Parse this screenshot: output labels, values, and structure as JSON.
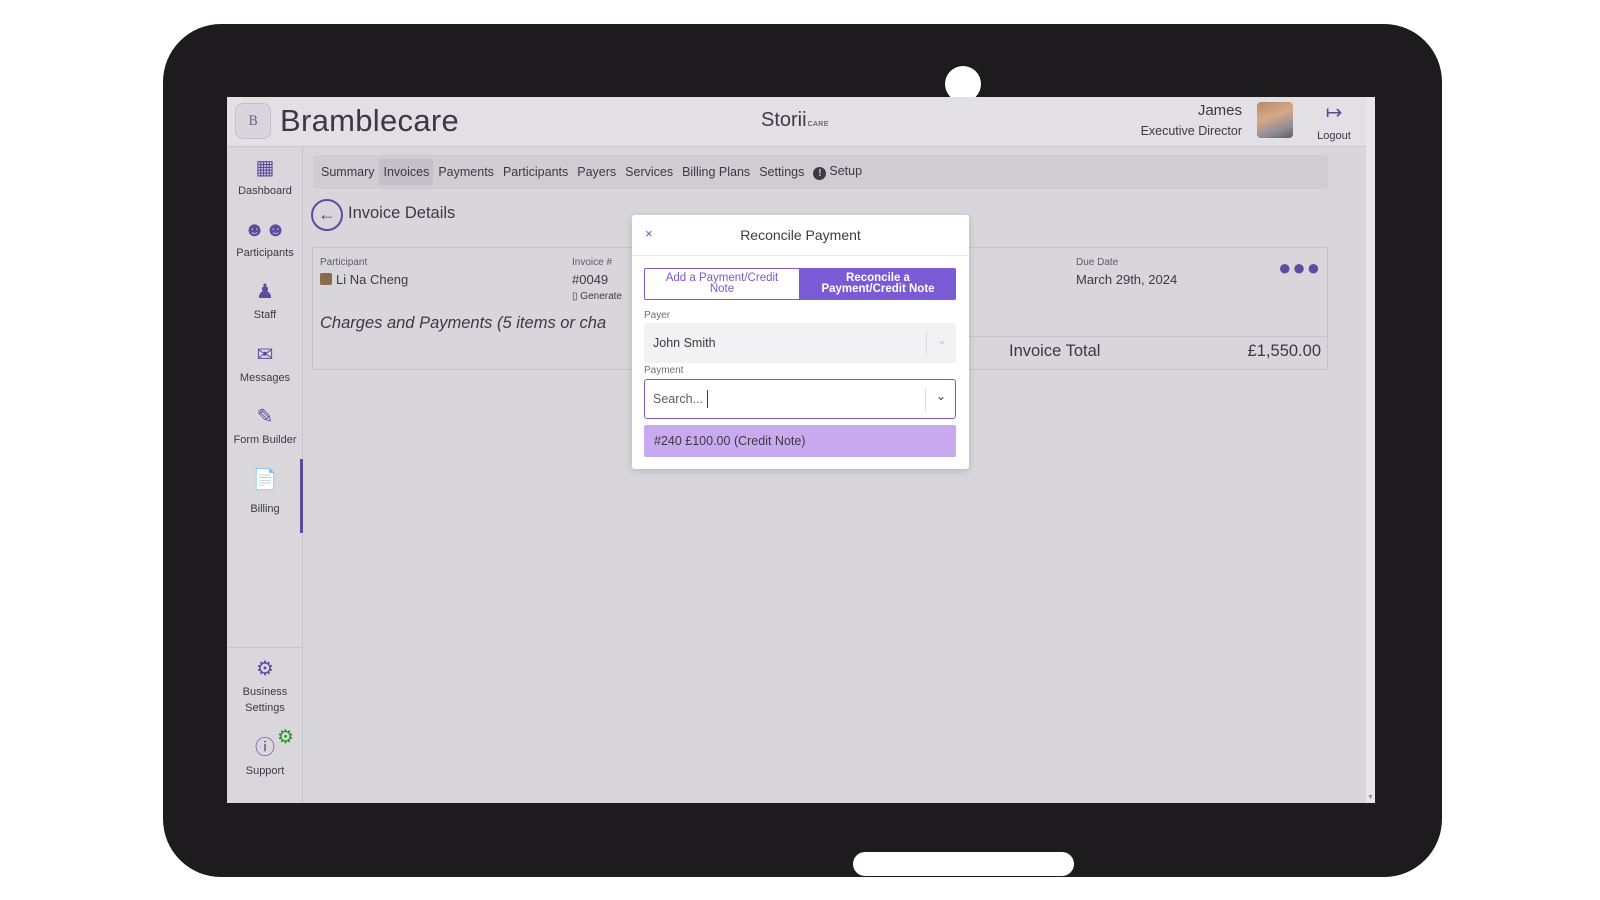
{
  "header": {
    "brand": "Bramblecare",
    "logo_mark": "B",
    "product": "Storii",
    "product_suffix": "CARE",
    "user_name": "James",
    "user_role": "Executive Director",
    "logout_label": "Logout"
  },
  "sidebar": {
    "items": [
      {
        "label": "Dashboard",
        "icon": "grid-icon"
      },
      {
        "label": "Participants",
        "icon": "people-icon"
      },
      {
        "label": "Staff",
        "icon": "staff-icon"
      },
      {
        "label": "Messages",
        "icon": "chat-icon"
      },
      {
        "label": "Form Builder",
        "icon": "form-builder-icon"
      },
      {
        "label": "Billing",
        "icon": "billing-icon"
      }
    ],
    "bottom": [
      {
        "label_line1": "Business",
        "label_line2": "Settings",
        "icon": "gear-icon"
      },
      {
        "label": "Support",
        "icon": "help-icon"
      }
    ],
    "active": "Billing"
  },
  "tabs": {
    "items": [
      "Summary",
      "Invoices",
      "Payments",
      "Participants",
      "Payers",
      "Services",
      "Billing Plans",
      "Settings"
    ],
    "setup_label": "Setup",
    "setup_badge": "!",
    "active": "Invoices"
  },
  "page": {
    "title": "Invoice Details"
  },
  "invoice": {
    "participant_label": "Participant",
    "participant_value": "Li Na Cheng",
    "invoice_label": "Invoice #",
    "invoice_value": "#0049",
    "generated_text": "Generate",
    "due_label": "Due Date",
    "due_value": "March 29th, 2024",
    "charges_heading": "Charges and Payments (5 items or cha",
    "total_label": "Invoice Total",
    "total_value": "£1,550.00"
  },
  "modal": {
    "close": "×",
    "title": "Reconcile Payment",
    "tab_add": "Add a Payment/Credit Note",
    "tab_reconcile": "Reconcile a Payment/Credit Note",
    "payer_label": "Payer",
    "payer_value": "John Smith",
    "payment_label": "Payment",
    "payment_placeholder": "Search...",
    "option": "#240 £100.00 (Credit Note)"
  },
  "colors": {
    "accent": "#7b5ad6",
    "sidebar_icon": "#5d4b9e",
    "option_highlight": "#c9aaf1"
  }
}
